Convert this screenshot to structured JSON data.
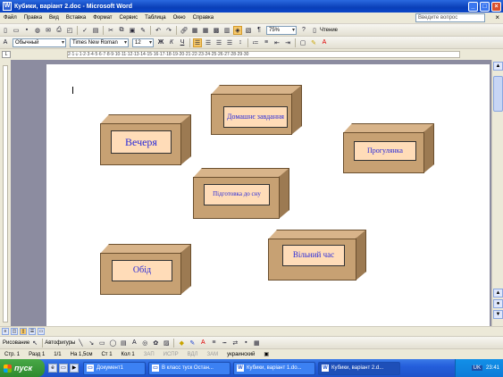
{
  "window": {
    "title": "Кубики, варіант 2.doc - Microsoft Word",
    "app_icon": "W",
    "controls": [
      "_",
      "□",
      "×"
    ]
  },
  "menu": {
    "items": [
      "Файл",
      "Правка",
      "Вид",
      "Вставка",
      "Формат",
      "Сервис",
      "Таблица",
      "Окно",
      "Справка"
    ],
    "ask_placeholder": "Введите вопрос",
    "close": "×"
  },
  "toolbar": {
    "zoom": "75%",
    "read_label": "Чтение"
  },
  "formatting": {
    "style": "Обычный",
    "font": "Times New Roman",
    "size": "12"
  },
  "ruler": {
    "marks": "2·1·🠗·1·2·3·4·5·6·7·8·9·10·11·12·13·14·15·16·17·18·19·20·21·22·23·24·25·26·27·28·29·30"
  },
  "boxes": [
    {
      "name": "Вечеря"
    },
    {
      "name": "Домашнє завдання"
    },
    {
      "name": "Прогулянка"
    },
    {
      "name": "Підготовка до сну"
    },
    {
      "name": "Обід"
    },
    {
      "name": "Вільний час"
    }
  ],
  "drawing_toolbar": {
    "draw_label": "Рисование",
    "autoshapes_label": "Автофигуры"
  },
  "status": {
    "page": "Стр. 1",
    "section": "Разд 1",
    "pages": "1/1",
    "at": "На 1,5см",
    "line": "Ст 1",
    "col": "Кол 1",
    "rec": "ЗАП",
    "trk": "ИСПР",
    "ext": "ВДЛ",
    "ovr": "ЗАМ",
    "lang": "украинский"
  },
  "taskbar": {
    "start_label": "пуск",
    "tasks": [
      "Документ1",
      "В класс туск Остан...",
      "Кубики, варіант 1.do...",
      "Кубики, варіант 2.d..."
    ],
    "tray_lang": "UK",
    "clock": "23:41"
  },
  "colors": {
    "box_front": "#c7a173",
    "box_label_bg": "#ffdcb8",
    "box_text": "#2a2ad8",
    "page": "#ffffff",
    "workspace": "#8c8ca0",
    "titlebar": "#0a3fb8"
  }
}
